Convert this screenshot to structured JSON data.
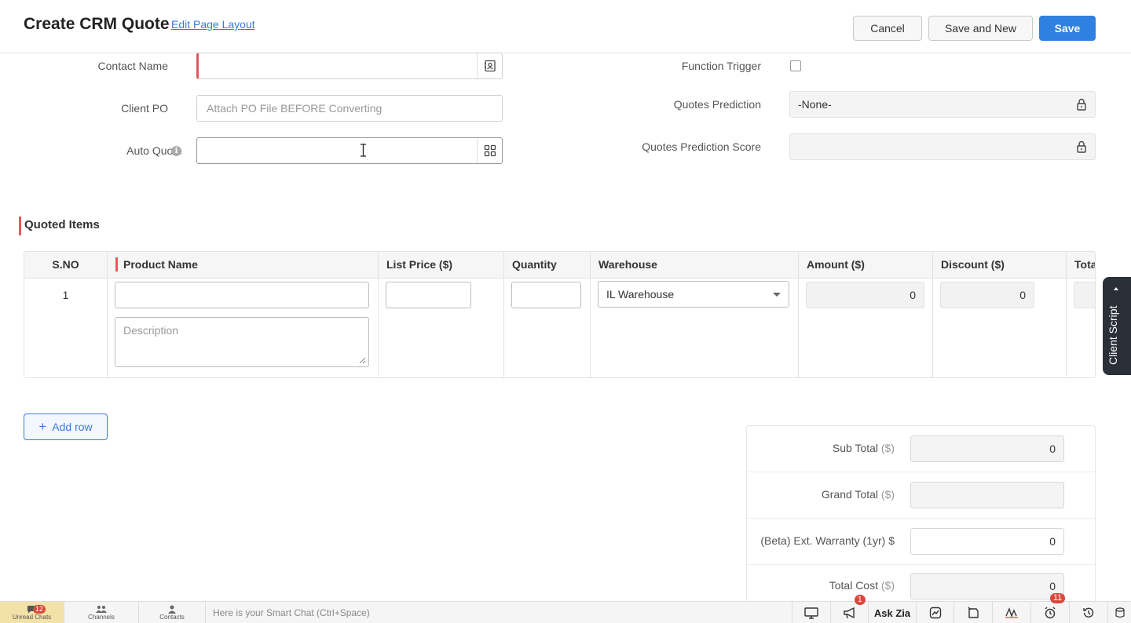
{
  "header": {
    "title": "Create CRM Quote",
    "edit_layout": "Edit Page Layout",
    "cancel": "Cancel",
    "save_and_new": "Save and New",
    "save": "Save"
  },
  "form": {
    "contact_name_label": "Contact Name",
    "client_po_label": "Client PO",
    "client_po_placeholder": "Attach PO File BEFORE Converting",
    "auto_quote_label": "Auto Quote",
    "function_trigger_label": "Function Trigger",
    "function_trigger_checked": false,
    "quotes_prediction_label": "Quotes Prediction",
    "quotes_prediction_value": "-None-",
    "quotes_prediction_score_label": "Quotes Prediction Score"
  },
  "quoted_items": {
    "title": "Quoted Items",
    "columns": [
      "S.NO",
      "Product Name",
      "List Price ($)",
      "Quantity",
      "Warehouse",
      "Amount ($)",
      "Discount ($)",
      "Tota"
    ],
    "rows": [
      {
        "sno": "1",
        "description_placeholder": "Description",
        "warehouse": "IL Warehouse",
        "amount": "0",
        "discount": "0"
      }
    ],
    "add_row": "Add row"
  },
  "totals": [
    {
      "label": "Sub Total",
      "currency": "($)",
      "value": "0"
    },
    {
      "label": "Grand Total",
      "currency": "($)",
      "value": ""
    },
    {
      "label": "(Beta) Ext. Warranty (1yr) $",
      "currency": "",
      "value": "0"
    },
    {
      "label": "Total Cost",
      "currency": "($)",
      "value": "0"
    }
  ],
  "client_script": "Client Script",
  "bottom_bar": {
    "unread_chats": "Unread Chats",
    "unread_count": "12",
    "channels": "Channels",
    "contacts": "Contacts",
    "smart_chat_placeholder": "Here is your Smart Chat (Ctrl+Space)",
    "ask_zia": "Ask Zia",
    "announcement_badge": "1",
    "alarm_badge": "11"
  },
  "colors": {
    "primary": "#2f80e0",
    "required": "#e05a5a",
    "link": "#3a7bd5",
    "client_script_bg": "#2b2f38"
  }
}
